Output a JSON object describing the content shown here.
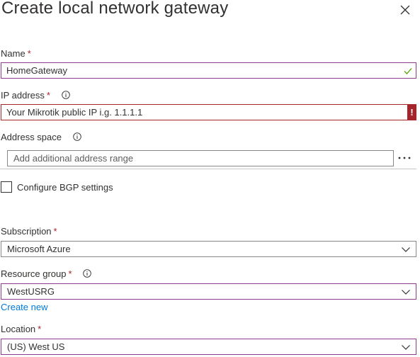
{
  "header": {
    "title": "Create local network gateway",
    "close_icon": "close-icon"
  },
  "name": {
    "label": "Name",
    "required_mark": "*",
    "value": "HomeGateway",
    "status_icon": "check-icon"
  },
  "ip_address": {
    "label": "IP address",
    "required_mark": "*",
    "value": "Your Mikrotik public IP i.g. 1.1.1.1",
    "error_mark": "!",
    "info_icon": "info-icon"
  },
  "address_space": {
    "label": "Address space",
    "placeholder": "Add additional address range",
    "more_icon": "ellipsis-icon",
    "info_icon": "info-icon"
  },
  "bgp": {
    "label": "Configure BGP settings",
    "checked": false
  },
  "subscription": {
    "label": "Subscription",
    "required_mark": "*",
    "value": "Microsoft Azure"
  },
  "resource_group": {
    "label": "Resource group",
    "required_mark": "*",
    "value": "WestUSRG",
    "create_new": "Create new"
  },
  "location": {
    "label": "Location",
    "required_mark": "*",
    "value": "(US) West US"
  },
  "colors": {
    "error": "#a4262c",
    "valid": "#57a300",
    "accent_border": "#8c3a8c",
    "link": "#0078d4"
  }
}
